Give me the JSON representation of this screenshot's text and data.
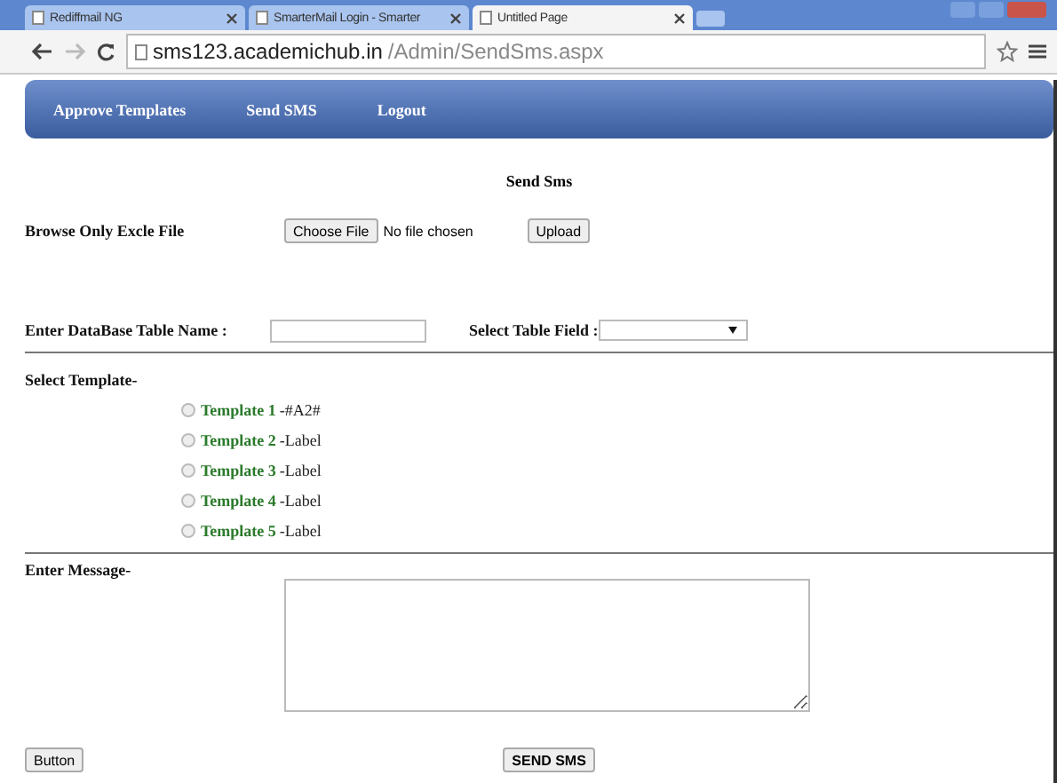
{
  "browser": {
    "tabs": [
      {
        "title": "Rediffmail NG",
        "selected": false
      },
      {
        "title": "SmarterMail Login - Smarter",
        "selected": false
      },
      {
        "title": "Untitled Page",
        "selected": true
      }
    ],
    "address": {
      "host": "sms123.academichub.in",
      "path": "/Admin/SendSms.aspx"
    }
  },
  "nav": [
    "Approve Templates",
    "Send SMS",
    "Logout"
  ],
  "page_title": "Send Sms",
  "upload": {
    "label": "Browse Only Excle File",
    "choose": "Choose File",
    "status": "No file chosen",
    "button": "Upload"
  },
  "table_row": {
    "label": "Enter DataBase Table Name :",
    "field_label": "Select Table Field :"
  },
  "templates": {
    "label": "Select Template-",
    "items": [
      {
        "name": "Template 1",
        "text": "-#A2#",
        "selected": false
      },
      {
        "name": "Template 2",
        "text": "-Label",
        "selected": false
      },
      {
        "name": "Template 3",
        "text": "-Label",
        "selected": false
      },
      {
        "name": "Template 4",
        "text": "-Label",
        "selected": false
      },
      {
        "name": "Template 5",
        "text": "-Label",
        "selected": false
      }
    ]
  },
  "message": {
    "label": "Enter Message-"
  },
  "buttons": [
    "Button",
    "SEND SMS"
  ]
}
